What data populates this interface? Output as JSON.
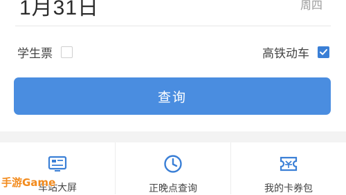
{
  "date": {
    "text": "1月31日",
    "weekday": "周四"
  },
  "options": {
    "student_label": "学生票",
    "student_checked": false,
    "highspeed_label": "高铁动车",
    "highspeed_checked": true
  },
  "query_button": {
    "label": "查询"
  },
  "bottom_nav": [
    {
      "label": "车站大屏",
      "icon": "station-screen-icon"
    },
    {
      "label": "正晚点查询",
      "icon": "clock-icon"
    },
    {
      "label": "我的卡券包",
      "icon": "ticket-icon"
    }
  ],
  "watermark": {
    "text": "手游Game"
  },
  "colors": {
    "accent": "#4a8de0",
    "icon": "#3a7fd6",
    "watermark": "#f28a1c"
  }
}
